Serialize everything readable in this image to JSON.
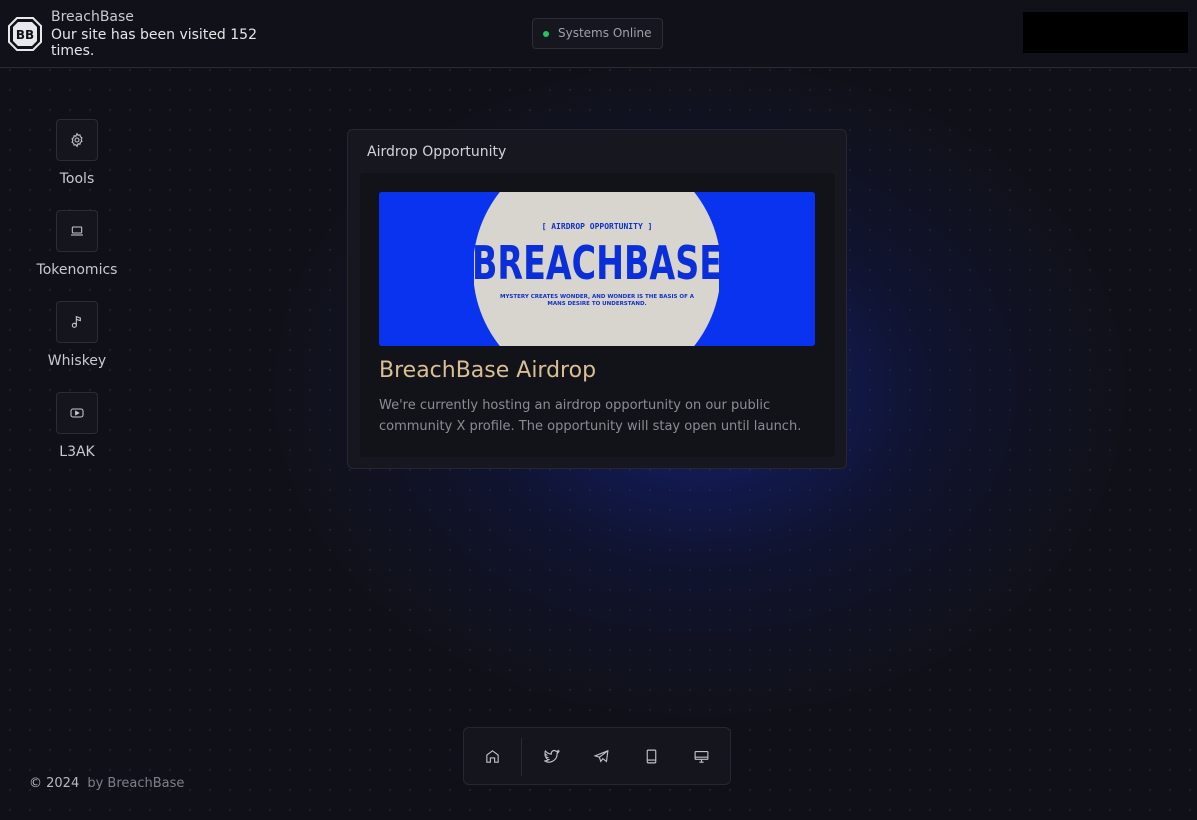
{
  "header": {
    "logo_text": "BB",
    "brand": "BreachBase",
    "visits": "Our site has been visited 152 times.",
    "status": "Systems Online",
    "status_color": "#22c55e"
  },
  "sidebar": {
    "items": [
      {
        "label": "Tools",
        "icon": "gear-icon"
      },
      {
        "label": "Tokenomics",
        "icon": "laptop-icon"
      },
      {
        "label": "Whiskey",
        "icon": "music-note-icon"
      },
      {
        "label": "L3AK",
        "icon": "youtube-icon"
      }
    ]
  },
  "panel": {
    "title": "Airdrop Opportunity",
    "banner": {
      "top_text": "[ AIRDROP OPPORTUNITY ]",
      "big_text": "BREACHBASE",
      "caption_line1": "MYSTERY CREATES WONDER, AND WONDER IS THE BASIS OF A",
      "caption_line2": "MANS DESIRE TO UNDERSTAND.",
      "bg_color": "#0a33f0"
    },
    "card_title": "BreachBase Airdrop",
    "card_desc": "We're currently hosting an airdrop opportunity on our public community X profile. The opportunity will stay open until launch."
  },
  "dock": {
    "items": [
      "home-icon",
      "twitter-icon",
      "telegram-icon",
      "tablet-icon",
      "monitor-icon"
    ]
  },
  "footer": {
    "copyright": "© 2024",
    "by": "by BreachBase"
  },
  "colors": {
    "accent_gold": "#d9be96",
    "glow_blue": "#162cb4"
  }
}
